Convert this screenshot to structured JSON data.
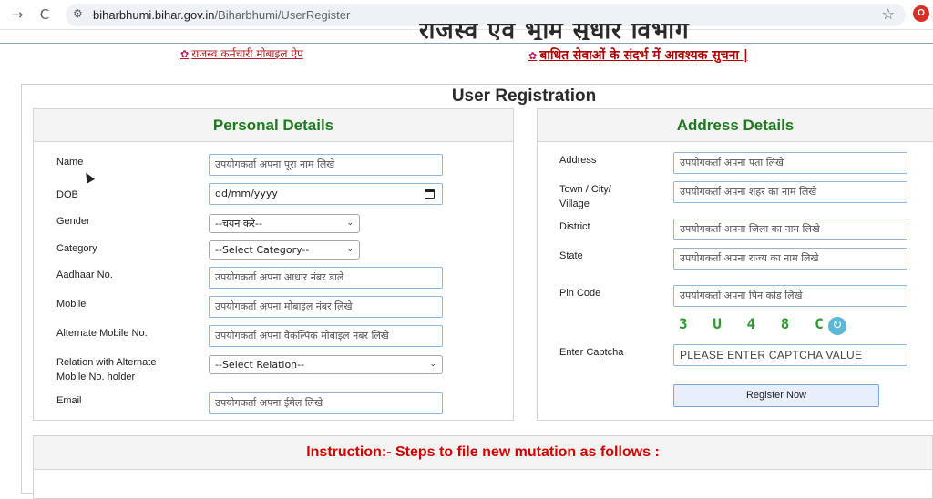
{
  "browser": {
    "back": "→",
    "reload": "C",
    "url_host": "biharbhumi.bihar.gov.in",
    "url_path": "/Biharbhumi/UserRegister",
    "star": "☆",
    "ext_badge": "O"
  },
  "banner": {
    "heading_cut": "राजस्व एवं भूमि सुधार विभाग",
    "app_link": "राजस्व कर्मचारी मोबाइल ऐप",
    "notice_link": "बाधित सेवाओं के संदर्भ में आवश्यक सुचना |"
  },
  "page": {
    "title": "User Registration"
  },
  "personal": {
    "heading": "Personal Details",
    "name_label": "Name",
    "name_placeholder": "उपयोगकर्ता अपना पूरा नाम लिखे",
    "dob_label": "DOB",
    "dob_value": "dd/mm/yyyy",
    "gender_label": "Gender",
    "gender_value": "--चयन करे--",
    "category_label": "Category",
    "category_value": "--Select Category--",
    "aadhaar_label": "Aadhaar No.",
    "aadhaar_placeholder": "उपयोगकर्ता अपना आधार नंबर डाले",
    "mobile_label": "Mobile",
    "mobile_placeholder": "उपयोगकर्ता अपना मोबाइल नंबर लिखे",
    "alt_mobile_label": "Alternate Mobile No.",
    "alt_mobile_placeholder": "उपयोगकर्ता अपना वैकल्पिक मोबाइल नंबर लिखे",
    "relation_label_1": "Relation with Alternate",
    "relation_label_2": "Mobile No. holder",
    "relation_value": "--Select Relation--",
    "email_label": "Email",
    "email_placeholder": "उपयोगकर्ता अपना ईमेल लिखे"
  },
  "address": {
    "heading": "Address Details",
    "address_label": "Address",
    "address_placeholder": "उपयोगकर्ता अपना पता लिखे",
    "town_label_1": "Town / City/",
    "town_label_2": "Village",
    "town_placeholder": "उपयोगकर्ता अपना शहर का नाम लिखे",
    "district_label": "District",
    "district_placeholder": "उपयोगकर्ता अपना जिला का नाम लिखे",
    "state_label": "State",
    "state_placeholder": "उपयोगकर्ता अपना राज्य का नाम लिखे",
    "pin_label": "Pin Code",
    "pin_placeholder": "उपयोगकर्ता अपना पिन कोड लिखे",
    "captcha_text": "3 U 4 8 C",
    "captcha_label": "Enter Captcha",
    "captcha_placeholder": "PLEASE ENTER CAPTCHA VALUE",
    "register_label": "Register Now"
  },
  "instruction": {
    "heading": "Instruction:- Steps to file new mutation as follows :"
  },
  "colors": {
    "section_heading": "#1e7a1e",
    "instruction_heading": "#d40000",
    "link_red": "#b22222"
  }
}
